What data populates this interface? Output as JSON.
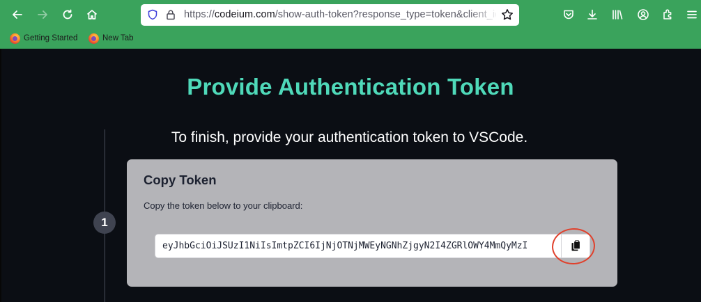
{
  "browser": {
    "url": {
      "scheme": "https://",
      "host": "codeium.com",
      "path": "/show-auth-token?response_type=token&client_id"
    },
    "bookmarks": [
      {
        "label": "Getting Started"
      },
      {
        "label": "New Tab"
      }
    ]
  },
  "page": {
    "title": "Provide Authentication Token",
    "subtitle": "To finish, provide your authentication token to VSCode.",
    "step_number": "1",
    "card": {
      "title": "Copy Token",
      "description": "Copy the token below to your clipboard:",
      "token_value": "eyJhbGciOiJSUzI1NiIsImtpZCI6IjNjOTNjMWEyNGNhZjgyN2I4ZGRlOWY4MmQyMzI"
    }
  },
  "colors": {
    "chrome_bg": "#3aa35c",
    "page_bg": "#0b0e14",
    "title_accent": "#4fd9b9",
    "card_bg": "#b4b4b8",
    "annotation_ring": "#e0402b"
  },
  "icons": [
    "back-arrow-icon",
    "forward-arrow-icon",
    "reload-icon",
    "home-icon",
    "tracking-shield-icon",
    "lock-icon",
    "bookmark-star-icon",
    "pocket-icon",
    "downloads-icon",
    "library-icon",
    "account-icon",
    "extensions-icon",
    "menu-icon",
    "firefox-icon",
    "clipboard-copy-icon"
  ]
}
